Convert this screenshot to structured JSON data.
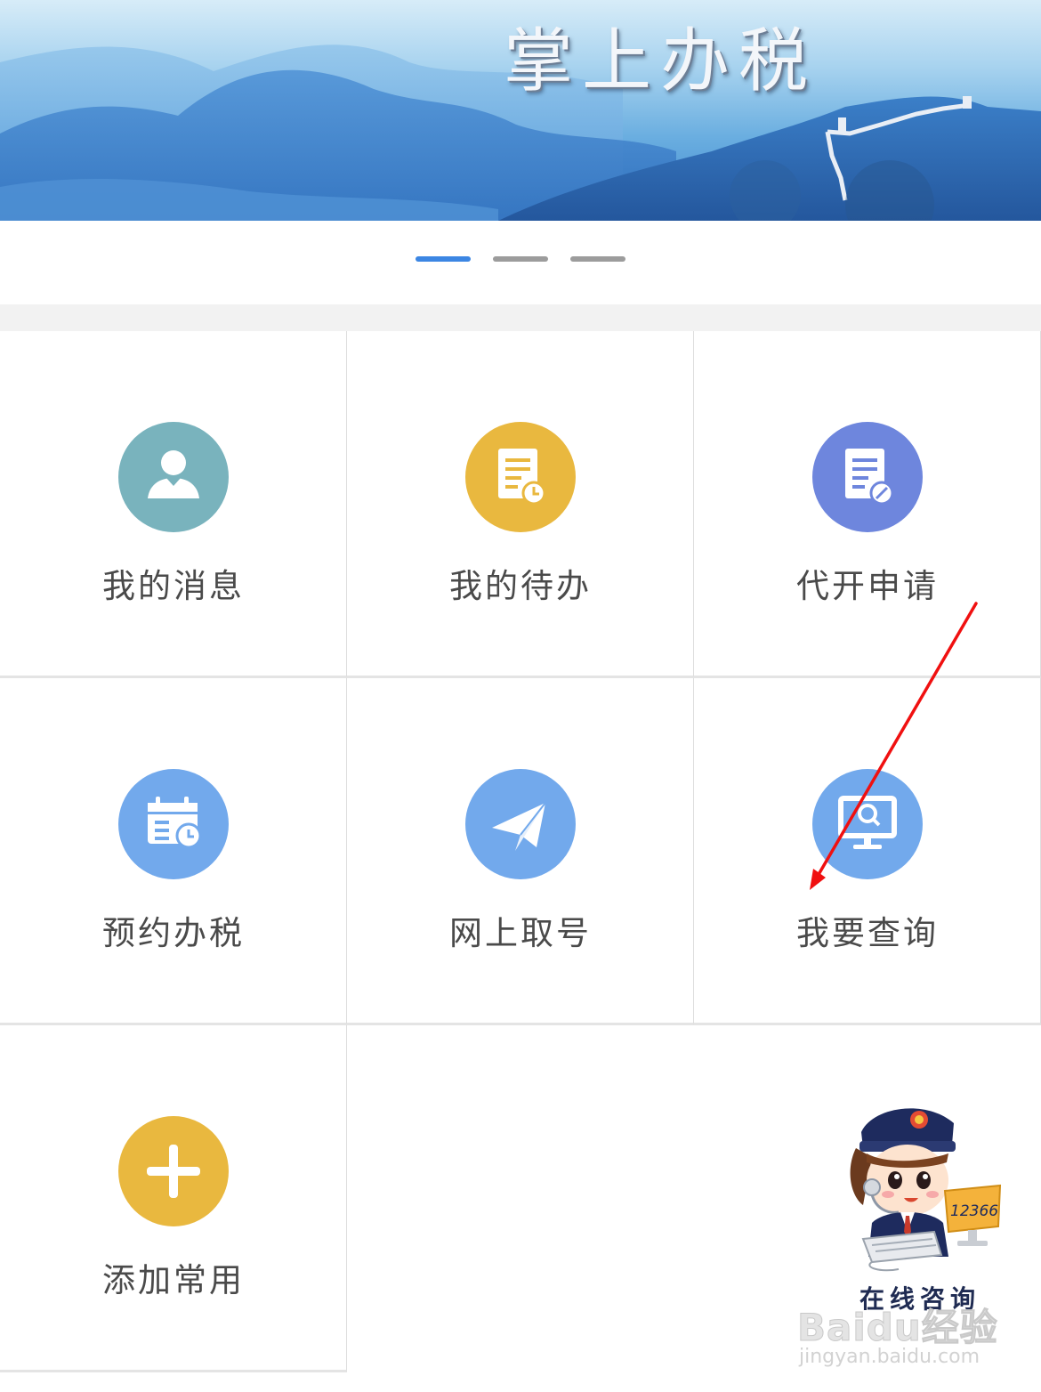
{
  "banner": {
    "title": "掌上办税",
    "slides": 3,
    "active_slide": 1
  },
  "grid": {
    "items": [
      {
        "label": "我的消息",
        "icon": "user-icon",
        "color": "#79b3bd"
      },
      {
        "label": "我的待办",
        "icon": "document-clock-icon",
        "color": "#e9b83f"
      },
      {
        "label": "代开申请",
        "icon": "document-edit-icon",
        "color": "#6e86dd"
      },
      {
        "label": "预约办税",
        "icon": "calendar-clock-icon",
        "color": "#72a9ec"
      },
      {
        "label": "网上取号",
        "icon": "paper-plane-icon",
        "color": "#72a9ec"
      },
      {
        "label": "我要查询",
        "icon": "monitor-search-icon",
        "color": "#72a9ec"
      },
      {
        "label": "添加常用",
        "icon": "plus-icon",
        "color": "#e9b83f"
      }
    ]
  },
  "mascot": {
    "label": "在线咨询",
    "screen_text": "12366",
    "icon": "customer-service-mascot"
  },
  "annotation": {
    "arrow_color": "#f01010"
  },
  "watermark": {
    "main": "Baidu经验",
    "sub": "jingyan.baidu.com"
  }
}
